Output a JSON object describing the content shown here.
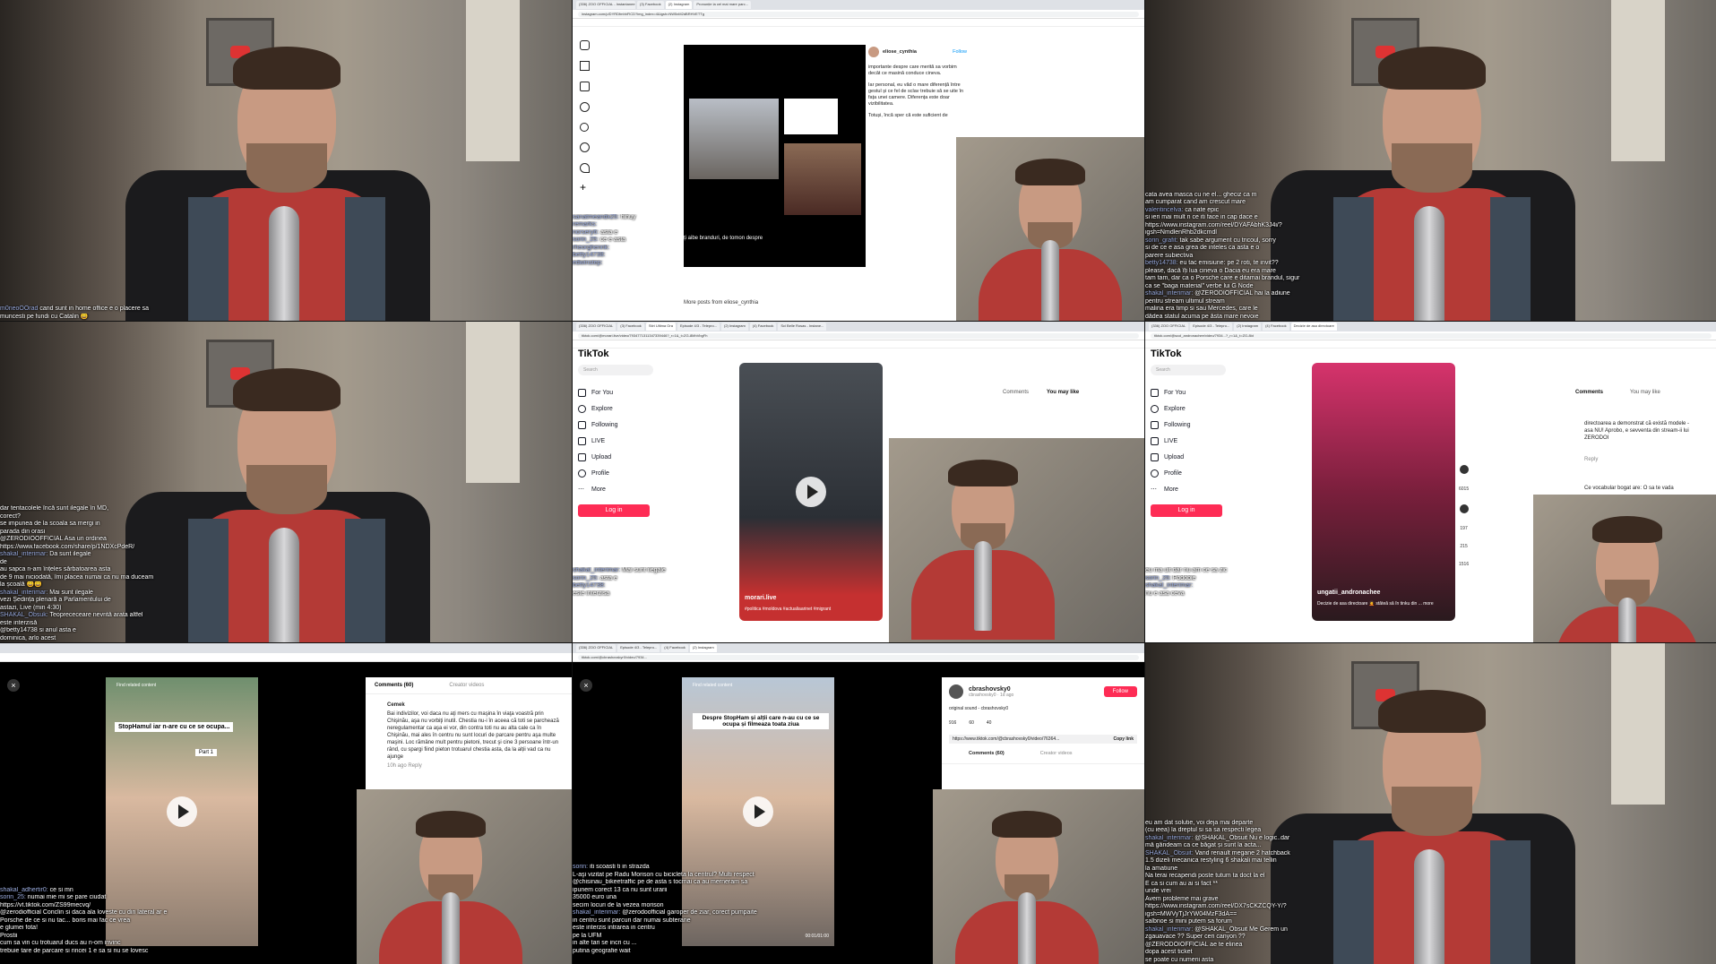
{
  "tiles": {
    "t1": {
      "chat": [
        {
          "user": "m0neoOOrad",
          "text": "cand sunt in home office e o placere sa"
        },
        {
          "user": "",
          "text": "muncesti pe fundi cu Catalin 😄"
        }
      ]
    },
    "t2": {
      "tabs": [
        "(336) ZOO OFFICIAL - Instantanee e n",
        "(3) Facebook",
        "(2) Instagram",
        "Pronunție la cel mai mare parc..."
      ],
      "url": "instagram.com/p/DYRDfmhhFlCD?img_index=4&igsh=NW5xM2dBRHVETTg",
      "profile_name": "eliose_cynthia",
      "follow": "Follow",
      "post_text_1": "importante despre care merită sa vorbim decât ce masină conduce cineva.",
      "post_text_2": "Iar personal, eu văd o mare diferență între gestul și ce fel de sclav trebuie să se uite în fața unei camere. Diferența este doar vizibilitatea.",
      "post_text_3": "Totuși, încă sper că este suficient de",
      "overlay_caption": "ți aibe branduri, de tomon despre",
      "more_posts": "More posts from eliose_cynthia",
      "chat": [
        {
          "user": "sanatmeandx25:",
          "text": "hihuy"
        },
        {
          "user": "remarks:",
          "text": ""
        },
        {
          "user": "norsery6:",
          "text": "asta e"
        },
        {
          "user": "sorin_25:",
          "text": "ce e asta"
        },
        {
          "user": "rheorghennk:",
          "text": ""
        },
        {
          "user": "betty14738:",
          "text": ""
        },
        {
          "user": "edwinstep:",
          "text": ""
        }
      ]
    },
    "t3": {
      "chat": [
        {
          "user": "",
          "text": "cata avea masca cu ne el... gheciz ca m"
        },
        {
          "user": "",
          "text": "am cumparat cand am crescut mare"
        },
        {
          "user": "valentincelva:",
          "text": "ca nate epic"
        },
        {
          "user": "",
          "text": "si ieri mai mult n ce iti face in cap dace e"
        },
        {
          "user": "",
          "text": "https://www.instagram.com/reel/DYAFAbhK3J4i/?"
        },
        {
          "user": "",
          "text": "igsh=NmdlenRhb2dkcmdl"
        },
        {
          "user": "sorin_grafit:",
          "text": "tak sabe argument cu tricoul, sorry"
        },
        {
          "user": "",
          "text": "si de ce e asa grea de inteles ca asta e o"
        },
        {
          "user": "",
          "text": "parere subiectiva"
        },
        {
          "user": "betty14738:",
          "text": "eu tac emisiune: pe 2 roti, te invit??"
        },
        {
          "user": "",
          "text": "please, dacă îți lua cineva o Dacia eu era mare"
        },
        {
          "user": "",
          "text": "tam tam, dar ca o Porsche care e ditamai brandul, sigur"
        },
        {
          "user": "",
          "text": "ca se \"baga material\" verbe lui G Node"
        },
        {
          "user": "shakal_interimar:",
          "text": "@ZERODIOFFICIAL hai la adiune"
        },
        {
          "user": "",
          "text": "pentru stream ultimul stream"
        },
        {
          "user": "",
          "text": "malina era timp si sau Mercedes, care le"
        },
        {
          "user": "",
          "text": "dădea statul acuma pe ăsta mare nevoie"
        }
      ]
    },
    "t4": {
      "chat": [
        {
          "user": "",
          "text": "dar tentacolele încă sunt ilegale în MD,"
        },
        {
          "user": "",
          "text": "corect?"
        },
        {
          "user": "",
          "text": "se impunea de la scoala sa mergi in"
        },
        {
          "user": "",
          "text": "parada din orasi"
        },
        {
          "user": "",
          "text": "@ZERODIOOFFICIAL Asa un ordinea"
        },
        {
          "user": "",
          "text": "https://www.facebook.com/share/p/1NDXcPdeR/"
        },
        {
          "user": "shakal_interimar:",
          "text": "Da sunt ilegale"
        },
        {
          "user": "",
          "text": "de"
        },
        {
          "user": "",
          "text": "au sapca n-am înțeles sărbatoarea asta"
        },
        {
          "user": "",
          "text": "de 9 mai niciodată, îmi placea numai ca nu ma duceam"
        },
        {
          "user": "",
          "text": "la școală 😄😄"
        },
        {
          "user": "shakal_interimar:",
          "text": "Mai sunt ilegale"
        },
        {
          "user": "",
          "text": "vezi Ședința plenară a Parlamentului de"
        },
        {
          "user": "",
          "text": "astazi, Live (min 4:30)"
        },
        {
          "user": "SHAKAL_Obsuk:",
          "text": "Teoprececeare nevrită arata altfel"
        },
        {
          "user": "",
          "text": "este interzisă"
        },
        {
          "user": "",
          "text": "@betty14738 si anul asta e"
        },
        {
          "user": "",
          "text": "dominica, arlo acest"
        }
      ]
    },
    "t5": {
      "tabs": [
        "(336) ZOO OFFICIAL",
        "(3) Facebook",
        "Stiri Ultima Ora",
        "Episode 4/3 - Telepro...",
        "(2) Instagram",
        "(4) Facebook",
        "Sci Belle Rosas - Instane..."
      ],
      "url": "tiktok.com/@morari.live/video/7934771311347339446?_r=1&_t=ZG-8MhVbgFh",
      "logo": "TikTok",
      "search": "Search",
      "nav": [
        "For You",
        "Explore",
        "Following",
        "LIVE",
        "Upload",
        "Profile",
        "More"
      ],
      "login": "Log in",
      "video_caption": "morari.live",
      "video_hashtags": "#politica #moldova #actualiaarinet #migrant",
      "tabs_right": [
        "Comments",
        "You may like"
      ],
      "chat": [
        {
          "user": "shakal_interimar:",
          "text": "Mai sunt ilegale"
        },
        {
          "user": "sorin_25:",
          "text": "asta e"
        },
        {
          "user": "betty14738:",
          "text": ""
        },
        {
          "user": "",
          "text": "este interzisa"
        }
      ]
    },
    "t6": {
      "tabs": [
        "(336) ZOO OFFICIAL",
        "Episode 4/3 - Telepro...",
        "(2) Instagram",
        "(4) Facebook",
        "Decizie de asa directoare"
      ],
      "url": "tiktok.com/@scol_andronachee/video/7934...?_r=1&_t=ZG-8ld",
      "logo": "TikTok",
      "search": "Search",
      "nav": [
        "For You",
        "Explore",
        "Following",
        "LIVE",
        "Upload",
        "Profile",
        "More"
      ],
      "login": "Log in",
      "tabs_right": [
        "Comments",
        "You may like"
      ],
      "comment_1": "directoarea a demonstrat că există modele - asa NU! Aprobo, e sevventa din stream-ii lui ZERODOI",
      "reply": "Reply",
      "comment_2": "Ce vocabular bogat are: O sa te vada",
      "video_caption": "ungatii_andronachee",
      "video_desc": "Decizie de asa directoare 🤦 stăteă să în tinku din ... more",
      "stats": [
        "6015",
        "197",
        "215",
        "1516"
      ],
      "chat": [
        {
          "user": "",
          "text": "eu ma uit dar nu am ce sa zic"
        },
        {
          "user": "sorin_25:",
          "text": "Podobie"
        },
        {
          "user": "shakal_interimar:",
          "text": ""
        },
        {
          "user": "",
          "text": "nu e asa ceva"
        }
      ]
    },
    "t7": {
      "overlay_title": "StopHamul iar n-are cu ce se ocupa...",
      "part": "Part 1",
      "feed_header": "Find related content",
      "tabs_right": [
        "Comments (60)",
        "Creator videos"
      ],
      "comment_user": "Cemek",
      "comment_text": "Bai indivizilor, voi daca nu aţi mers cu maşina în viaţa voastră prin Chişinău, aşa nu vorbiţi inutil. Chestia nu-i în aceea că toti se parchează neregulamentar ca aşa ei vor, din contra toti nu au alta cale ca în Chişinău, mai ales în centru nu sunt locuri de parcare pentru aşa multe maşini. Loc rămâne mult pentru pietoni, trecut şi cine 3 persoane într-un rând, cu spargi fiind pieton trotuarul chestia asta, da la alții vad ca nu ajunge",
      "comment_meta": "10h ago   Reply",
      "chat": [
        {
          "user": "shakal_adhertir0:",
          "text": "ce si mn"
        },
        {
          "user": "sorin_25:",
          "text": "numai mie mi se pare ciudat"
        },
        {
          "user": "",
          "text": "https://vt.tiktok.com/ZS99mecvq/"
        },
        {
          "user": "",
          "text": "@zerodiofficial Conclin si daca ala loveste cu din lateral ar e"
        },
        {
          "user": "",
          "text": "Porsche de ce si nu tac... boris mai fac ce vrea"
        },
        {
          "user": "",
          "text": "e glumei fota!"
        },
        {
          "user": "",
          "text": "Prostii"
        },
        {
          "user": "",
          "text": "cum sa vin cu trotuarul ducs au n-om invinc"
        },
        {
          "user": "",
          "text": "trebuie tare de parcare si rincei 1 e sa si nu se lovesc"
        }
      ]
    },
    "t8": {
      "tabs": [
        "(336) ZOO OFFICIAL",
        "Episode 4/3 - Telepro...",
        "(4) Facebook",
        "(2) Instagram"
      ],
      "url": "tiktok.com/@cbrashovskyr0/video/7934...",
      "overlay_title": "Despre StopHam și alții care n-au cu ce se ocupa și filmeaza toata ziua",
      "feed_header": "Find related content",
      "profile_name": "cbrashovsky0",
      "profile_sub": "cbrashovsky0 · 1d ago",
      "follow": "Follow",
      "sound": "original sound - cbrashovsky0",
      "stats": [
        "916",
        "60",
        "40"
      ],
      "link": "https://www.tiktok.com/@cbrashovsky0/video/76364...",
      "copy_link": "Copy link",
      "tabs_right": [
        "Comments (60)",
        "Creator videos"
      ],
      "time": "00:01/01:00",
      "chat": [
        {
          "user": "sorin:",
          "text": "iti scoasti ti in strazda"
        },
        {
          "user": "",
          "text": "L-aşi vizitat pe Radu Morison cu bicicleta la centrul? Multi respect"
        },
        {
          "user": "",
          "text": "@chisinau_bikeetraffic pe de asta s tocmai ca au merneram sa"
        },
        {
          "user": "",
          "text": "ipunem corect 13 ca nu sunt urarii"
        },
        {
          "user": "",
          "text": "35000 euro una"
        },
        {
          "user": "",
          "text": "secim locuri de la vezea morison"
        },
        {
          "user": "shakal_interimar:",
          "text": "@zerodoofficial garoper de ziar, corect pumpaite"
        },
        {
          "user": "",
          "text": "in centru sunt parcuri dar numai subterane"
        },
        {
          "user": "",
          "text": "este interzis intrarea in centru"
        },
        {
          "user": "",
          "text": "pe la UFM"
        },
        {
          "user": "",
          "text": "in alte tari se incri cu ..."
        },
        {
          "user": "",
          "text": "putina geografie wait"
        }
      ]
    },
    "t9": {
      "chat": [
        {
          "user": "",
          "text": "eu am dat solutie, voi deja mai departe"
        },
        {
          "user": "",
          "text": "(cu ieea) la dreptul si sa sa respecti legea"
        },
        {
          "user": "shakal_interimar:",
          "text": "@SHAKAL_Obsuit Nu e logic..dar"
        },
        {
          "user": "",
          "text": "mă gândeam ca ce băgat și sunt la acta..."
        },
        {
          "user": "SHAKAL_Obsuit:",
          "text": "Vand renault megane 2 hatchback"
        },
        {
          "user": "",
          "text": "1.5 dizeli mecanica restyling 6 shakali mai tellin"
        },
        {
          "user": "",
          "text": "la amatiune"
        },
        {
          "user": "",
          "text": "Na terai recapendi poste tutum ta doct la el"
        },
        {
          "user": "",
          "text": "E ca si cum au ai si fact **"
        },
        {
          "user": "",
          "text": "unde vrei"
        },
        {
          "user": "",
          "text": "Avem probleme mai grave"
        },
        {
          "user": "",
          "text": "https://www.instagram.com/reel/DX7sCKZCQY-Y/?"
        },
        {
          "user": "",
          "text": "igsh=MWVyTjJrYW04MzF3dA=="
        },
        {
          "user": "",
          "text": "salbnoe si mini putem sa forum"
        },
        {
          "user": "shakal_interimar:",
          "text": "@SHAKAL_Obsuit Me Gerem un"
        },
        {
          "user": "",
          "text": "zgauavace ?? Super ceri canyon ??"
        },
        {
          "user": "",
          "text": "@ZERODOIOFFICIAL ae te elinea"
        },
        {
          "user": "",
          "text": "dopa acest ticket"
        },
        {
          "user": "",
          "text": "se poate cu numerii asta"
        }
      ]
    }
  }
}
